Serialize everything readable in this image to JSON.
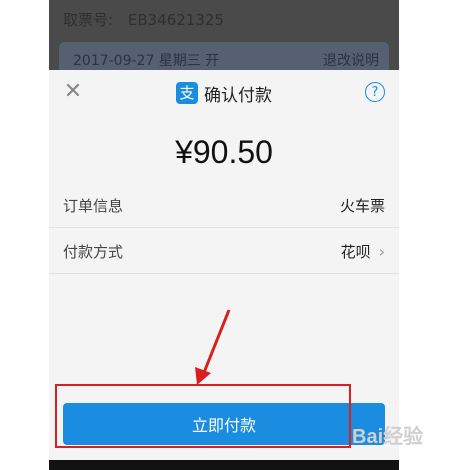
{
  "background": {
    "order_label": "取票号:",
    "order_value": "EB34621325",
    "date_text": "2017-09-27 星期三 开",
    "help_text": "退改说明"
  },
  "sheet": {
    "title": "确认付款",
    "amount": "¥90.50",
    "rows": [
      {
        "label": "订单信息",
        "value": "火车票"
      },
      {
        "label": "付款方式",
        "value": "花呗"
      }
    ],
    "pay_button": "立即付款"
  },
  "icons": {
    "close": "close-icon",
    "help": "help-icon",
    "logo": "alipay-logo-icon",
    "chevron": "chevron-right-icon"
  },
  "colors": {
    "accent": "#1a8de0",
    "highlight": "#d82020"
  },
  "watermark": "Bai经验"
}
